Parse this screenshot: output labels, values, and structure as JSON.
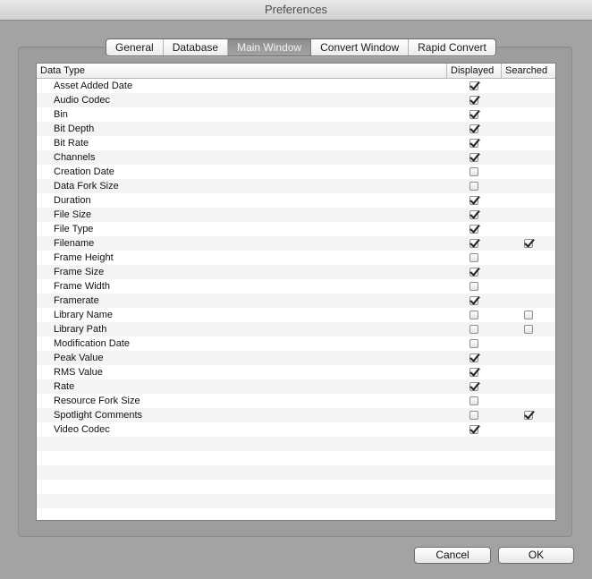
{
  "window": {
    "title": "Preferences"
  },
  "tabs": [
    {
      "label": "General",
      "selected": false
    },
    {
      "label": "Database",
      "selected": false
    },
    {
      "label": "Main Window",
      "selected": true
    },
    {
      "label": "Convert Window",
      "selected": false
    },
    {
      "label": "Rapid Convert",
      "selected": false
    }
  ],
  "table": {
    "columns": [
      "Data Type",
      "Displayed",
      "Searched"
    ],
    "rows": [
      {
        "name": "Asset Added Date",
        "displayed": true,
        "searched": null
      },
      {
        "name": "Audio Codec",
        "displayed": true,
        "searched": null
      },
      {
        "name": "Bin",
        "displayed": true,
        "searched": null
      },
      {
        "name": "Bit Depth",
        "displayed": true,
        "searched": null
      },
      {
        "name": "Bit Rate",
        "displayed": true,
        "searched": null
      },
      {
        "name": "Channels",
        "displayed": true,
        "searched": null
      },
      {
        "name": "Creation Date",
        "displayed": false,
        "searched": null
      },
      {
        "name": "Data Fork Size",
        "displayed": false,
        "searched": null
      },
      {
        "name": "Duration",
        "displayed": true,
        "searched": null
      },
      {
        "name": "File Size",
        "displayed": true,
        "searched": null
      },
      {
        "name": "File Type",
        "displayed": true,
        "searched": null
      },
      {
        "name": "Filename",
        "displayed": true,
        "searched": true
      },
      {
        "name": "Frame Height",
        "displayed": false,
        "searched": null
      },
      {
        "name": "Frame Size",
        "displayed": true,
        "searched": null
      },
      {
        "name": "Frame Width",
        "displayed": false,
        "searched": null
      },
      {
        "name": "Framerate",
        "displayed": true,
        "searched": null
      },
      {
        "name": "Library Name",
        "displayed": false,
        "searched": false
      },
      {
        "name": "Library Path",
        "displayed": false,
        "searched": false
      },
      {
        "name": "Modification Date",
        "displayed": false,
        "searched": null
      },
      {
        "name": "Peak Value",
        "displayed": true,
        "searched": null
      },
      {
        "name": "RMS Value",
        "displayed": true,
        "searched": null
      },
      {
        "name": "Rate",
        "displayed": true,
        "searched": null
      },
      {
        "name": "Resource Fork Size",
        "displayed": false,
        "searched": null
      },
      {
        "name": "Spotlight Comments",
        "displayed": false,
        "searched": true
      },
      {
        "name": "Video Codec",
        "displayed": true,
        "searched": null
      }
    ]
  },
  "buttons": {
    "cancel": "Cancel",
    "ok": "OK"
  }
}
